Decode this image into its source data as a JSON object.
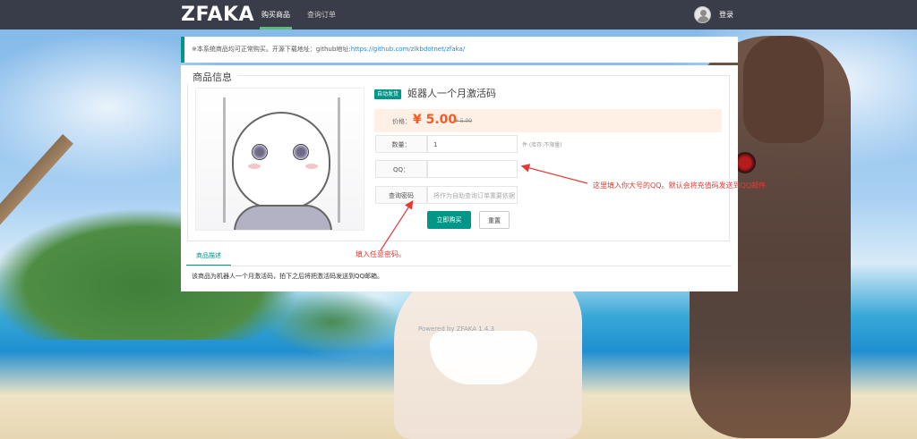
{
  "app": {
    "logo": "ZFAKA",
    "nav": {
      "buy": "购买商品",
      "orders": "查询订单"
    },
    "login": "登录"
  },
  "notice": {
    "prefix": "※本系统商品均可正常购买。开源下载地址：github地址:",
    "link": "https://github.com/zlkbdotnet/zfaka/"
  },
  "product": {
    "section_title": "商品信息",
    "badge": "自动发货",
    "name": "姬器人一个月激活码",
    "price_label": "价格：",
    "price": "¥ 5.00",
    "old_price": "¥ 5.00",
    "quantity_label": "数量：",
    "quantity_value": "1",
    "stock_text": "件 (库存:不限量)",
    "qq_label": "QQ：",
    "qq_value": "",
    "password_label": "查询密码",
    "password_placeholder": "将作为自助查询订单重要依据",
    "buy_button": "立即购买",
    "reset_button": "重置"
  },
  "tabs": {
    "description_tab": "商品描述",
    "description_text": "该商品为机器人一个月激活码，拍下之后将把激活码发送到QQ邮箱。"
  },
  "annotations": {
    "qq_hint": "这里填入你大号的QQ。默认会将充值码发送到QQ邮件",
    "password_hint": "填入任意密码。"
  },
  "footer": {
    "powered": "Powered by   ZFAKA 1.4.3"
  },
  "colors": {
    "topbar": "#393d49",
    "accent": "#009688",
    "price": "#ff5722",
    "annotation": "#e53935"
  }
}
